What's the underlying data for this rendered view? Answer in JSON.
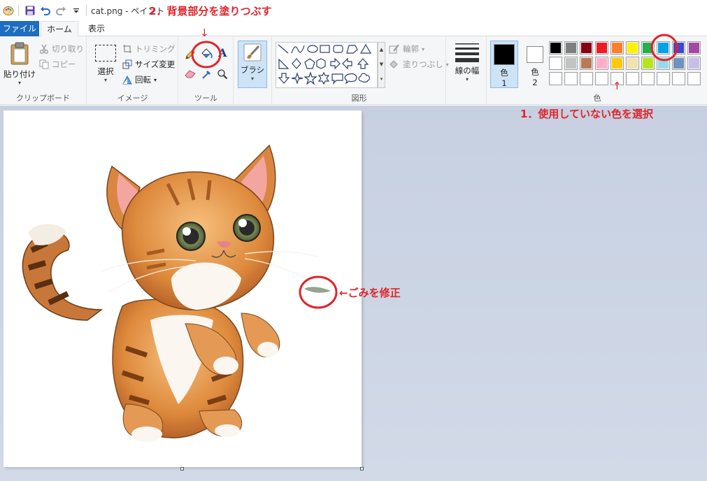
{
  "window": {
    "title": "cat.png - ペイント"
  },
  "tabs": [
    {
      "label": "ファイル"
    },
    {
      "label": "ホーム"
    },
    {
      "label": "表示"
    }
  ],
  "ribbon": {
    "clipboard": {
      "paste": "貼り付け",
      "cut": "切り取り",
      "copy": "コピー",
      "group": "クリップボード"
    },
    "image": {
      "select": "選択",
      "crop": "トリミング",
      "resize": "サイズ変更",
      "rotate": "回転",
      "group": "イメージ"
    },
    "tools": {
      "group": "ツール"
    },
    "brushes": {
      "label": "ブラシ"
    },
    "shapes": {
      "outline": "輪郭",
      "fill": "塗りつぶし",
      "group": "図形"
    },
    "size": {
      "label": "線の幅"
    },
    "colors": {
      "color1_label": "色",
      "color1_index": "1",
      "color2_label": "色",
      "color2_index": "2",
      "group": "色",
      "color1_value": "#000000",
      "color2_value": "#ffffff",
      "palette_row1": [
        "#000000",
        "#7f7f7f",
        "#880015",
        "#ed1c24",
        "#ff7f27",
        "#fff200",
        "#22b14c",
        "#00a2e8",
        "#3f48cc",
        "#a349a4"
      ],
      "palette_row2": [
        "#ffffff",
        "#c3c3c3",
        "#b97a57",
        "#ffaec9",
        "#ffc90e",
        "#efe4b0",
        "#b5e61d",
        "#99d9ea",
        "#7092be",
        "#c8bfe7"
      ]
    }
  },
  "annotations": {
    "step2": "2．背景部分を塗りつぶす",
    "step1": "1．使用していない色を選択",
    "fix": "←ごみを修正",
    "arrow_down": "↓",
    "arrow_up": "↑",
    "highlight_color": "#e0242b"
  }
}
